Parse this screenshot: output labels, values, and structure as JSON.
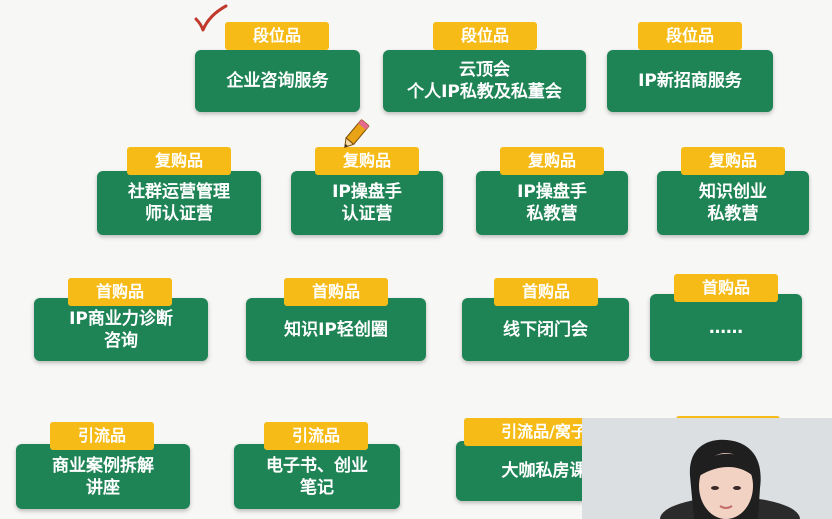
{
  "rows": [
    {
      "cards": [
        {
          "tag": "段位品",
          "lines": [
            "企业咨询服务"
          ]
        },
        {
          "tag": "段位品",
          "lines": [
            "云顶会",
            "个人IP私教及私董会"
          ]
        },
        {
          "tag": "段位品",
          "lines": [
            "IP新招商服务"
          ]
        }
      ]
    },
    {
      "cards": [
        {
          "tag": "复购品",
          "lines": [
            "社群运营管理",
            "师认证营"
          ]
        },
        {
          "tag": "复购品",
          "lines": [
            "IP操盘手",
            "认证营"
          ]
        },
        {
          "tag": "复购品",
          "lines": [
            "IP操盘手",
            "私教营"
          ]
        },
        {
          "tag": "复购品",
          "lines": [
            "知识创业",
            "私教营"
          ]
        }
      ]
    },
    {
      "cards": [
        {
          "tag": "首购品",
          "lines": [
            "IP商业力诊断",
            "咨询"
          ]
        },
        {
          "tag": "首购品",
          "lines": [
            "知识IP轻创圈"
          ]
        },
        {
          "tag": "首购品",
          "lines": [
            "线下闭门会"
          ]
        },
        {
          "tag": "首购品",
          "lines": [
            "……"
          ]
        }
      ]
    },
    {
      "cards": [
        {
          "tag": "引流品",
          "lines": [
            "商业案例拆解",
            "讲座"
          ]
        },
        {
          "tag": "引流品",
          "lines": [
            "电子书、创业",
            "笔记"
          ]
        },
        {
          "tag": "引流品/窝子",
          "lines": [
            "大咖私房课"
          ]
        },
        {
          "tag": "",
          "lines": []
        }
      ]
    }
  ],
  "colors": {
    "card": "#1e8355",
    "tag": "#f6bb16",
    "check": "#c0392b"
  },
  "icons": [
    "check-mark-icon",
    "pencil-icon"
  ]
}
